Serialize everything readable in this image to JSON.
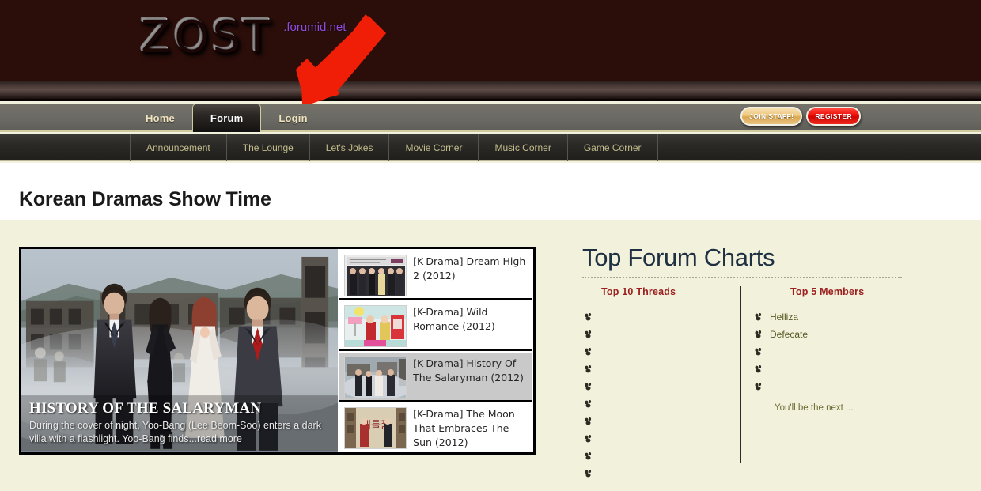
{
  "site": {
    "logo_text": "ZOST",
    "logo_domain": ".forumid.net"
  },
  "main_nav": {
    "items": [
      {
        "label": "Home",
        "active": false
      },
      {
        "label": "Forum",
        "active": true
      },
      {
        "label": "Login",
        "active": false
      }
    ],
    "buttons": {
      "staff_label": "JOIN STAFF!",
      "register_label": "REGISTER"
    }
  },
  "sub_nav": {
    "items": [
      {
        "label": "Announcement"
      },
      {
        "label": "The Lounge"
      },
      {
        "label": "Let's Jokes"
      },
      {
        "label": "Movie Corner"
      },
      {
        "label": "Music Corner"
      },
      {
        "label": "Game Corner"
      }
    ]
  },
  "page": {
    "title": "Korean Dramas Show Time"
  },
  "slider": {
    "featured": {
      "title": "HISTORY OF THE SALARYMAN",
      "description": "During the cover of night, Yoo-Bang (Lee Beom-Soo) enters a dark villa with a flashlight. Yoo-Bang finds...",
      "read_more": "read more"
    },
    "items": [
      {
        "title": "[K-Drama] Dream High 2 (2012)",
        "active": false
      },
      {
        "title": "[K-Drama] Wild Romance (2012)",
        "active": false
      },
      {
        "title": "[K-Drama] History Of The Salaryman (2012)",
        "active": true
      },
      {
        "title": "[K-Drama] The Moon That Embraces The Sun (2012)",
        "active": false
      }
    ]
  },
  "charts": {
    "heading": "Top Forum Charts",
    "threads": {
      "heading": "Top 10 Threads",
      "items": [
        "",
        "",
        "",
        "",
        "",
        "",
        "",
        "",
        "",
        ""
      ]
    },
    "members": {
      "heading": "Top 5 Members",
      "items": [
        "Helliza",
        "Defecate",
        "",
        "",
        ""
      ],
      "note": "You'll be the next ..."
    }
  },
  "colors": {
    "banner_bg": "#2B0E0A",
    "nav_bg": "#6B6A64",
    "subnav_bg": "#2B2A27",
    "page_bg": "#F2F1DC",
    "accent_cream": "#CFCAA0",
    "heading_blue": "#1E3042",
    "col_head_red": "#9C2020",
    "member_olive": "#585A25",
    "logo_domain_purple": "#8F4CE0",
    "arrow_red": "#F01E07"
  },
  "icons": {
    "bullet": "paw-bullet-icon",
    "arrow": "red-down-arrow-icon"
  }
}
